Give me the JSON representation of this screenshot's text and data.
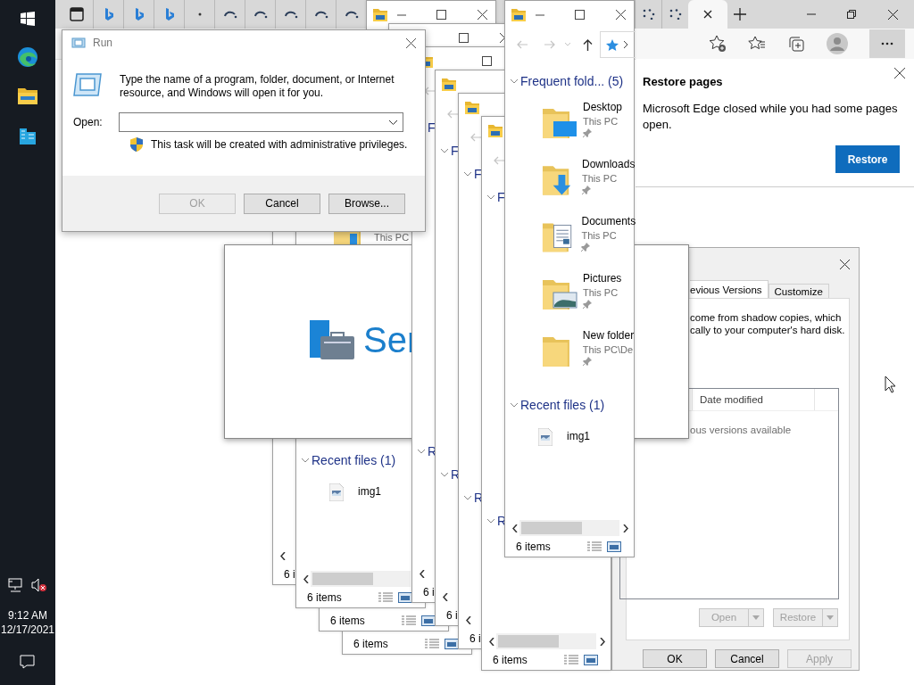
{
  "taskbar": {
    "apps": [
      {
        "kind": "start"
      },
      {
        "kind": "edge"
      },
      {
        "kind": "explorer"
      },
      {
        "kind": "server-manager"
      }
    ],
    "volume_muted": true,
    "time": "9:12 AM",
    "date": "12/17/2021"
  },
  "browser": {
    "tabs_left": [
      {
        "kind": "bing",
        "selected": false
      },
      {
        "kind": "bing",
        "selected": false
      },
      {
        "kind": "bing",
        "selected": false
      },
      {
        "kind": "dot",
        "selected": false
      },
      {
        "kind": "loading",
        "selected": false
      },
      {
        "kind": "loading",
        "selected": false
      },
      {
        "kind": "loading",
        "selected": false
      },
      {
        "kind": "loading",
        "selected": false
      },
      {
        "kind": "loading",
        "selected": false
      }
    ],
    "tabs_right": [
      {
        "kind": "dots",
        "selected": false
      },
      {
        "kind": "dots",
        "selected": false
      },
      {
        "kind": "blank",
        "selected": true
      }
    ],
    "restore_flyout": {
      "title": "Restore pages",
      "message": "Microsoft Edge closed while you had some pages open.",
      "button": "Restore"
    }
  },
  "properties_dialog": {
    "tabs": [
      {
        "label": "evious Versions",
        "selected": true
      },
      {
        "label": "Customize",
        "selected": false
      }
    ],
    "description": [
      "come from shadow copies, which",
      "cally to your computer's hard disk."
    ],
    "column": "Date modified",
    "empty_message": "ous versions available",
    "action_buttons": [
      {
        "label": "Open",
        "disabled": true
      },
      {
        "label": "Restore",
        "disabled": true
      }
    ],
    "buttons": [
      {
        "label": "OK",
        "disabled": false
      },
      {
        "label": "Cancel",
        "disabled": false
      },
      {
        "label": "Apply",
        "disabled": true
      }
    ]
  },
  "explorer_windows": [
    {
      "title_bar": {
        "icon": true,
        "minimize": true,
        "maximize": true,
        "close": true
      }
    },
    {
      "title_bar": {
        "maximize": true,
        "close": true
      }
    },
    {
      "status": "6 items",
      "view_buttons": true
    },
    {
      "status": "6 items",
      "view_buttons": true
    },
    {
      "scrollbar": {
        "left_arrow": true
      },
      "status": "6 i"
    },
    {
      "items": [
        {
          "kind": "downloads",
          "location": "This PC"
        }
      ],
      "recent_header": "Recent files (1)",
      "recent_items": [
        "img1"
      ],
      "scrollbar": {
        "left_arrow": true,
        "thumb": true
      },
      "status": "6 items",
      "view_buttons": true
    },
    {
      "title_bar": {
        "icon": true,
        "maximize": true
      },
      "nav": {
        "back": true
      },
      "frequent_header": "F",
      "recent_header": "R",
      "scrollbar": {
        "left_arrow": true
      },
      "status": "6 i"
    },
    {
      "title_bar": {
        "icon": true
      },
      "nav": {
        "back": true
      },
      "frequent_header": "F",
      "recent_header": "R",
      "scrollbar": {
        "left_arrow": true
      },
      "status": "6 i"
    },
    {
      "title_bar": {
        "icon": true
      },
      "nav": {
        "back": true
      },
      "frequent_header": "F",
      "recent_header": "R",
      "scrollbar": {
        "left_arrow": true
      },
      "status": "6 i"
    },
    {
      "title_bar": {
        "icon": true
      },
      "nav": {
        "back": true
      },
      "frequent_header": "F",
      "recent_header": "R",
      "scrollbar": {
        "left_arrow": true,
        "thumb": true,
        "right_arrow": true
      },
      "status": "6 items",
      "view_buttons": true
    },
    {
      "title_bar": {
        "icon": true,
        "minimize": true,
        "maximize": true,
        "close": true
      },
      "nav": {
        "back": true,
        "forward": true,
        "recent": true,
        "up": true,
        "address": true
      },
      "frequent_header": "Frequent fold... (5)",
      "items": [
        {
          "kind": "desktop",
          "name": "Desktop",
          "location": "This PC",
          "pinned": true
        },
        {
          "kind": "downloads",
          "name": "Downloads",
          "location": "This PC",
          "pinned": true
        },
        {
          "kind": "documents",
          "name": "Documents",
          "location": "This PC",
          "pinned": true
        },
        {
          "kind": "pictures",
          "name": "Pictures",
          "location": "This PC",
          "pinned": true
        },
        {
          "kind": "folder",
          "name": "New folder",
          "location": "This PC\\De",
          "pinned": true
        }
      ],
      "recent_header": "Recent files (1)",
      "recent_items": [
        "img1"
      ],
      "scrollbar": {
        "left_arrow": true,
        "thumb": true,
        "right_arrow": true
      },
      "status": "6 items",
      "view_buttons": true
    }
  ],
  "splash": {
    "title": "Ser"
  },
  "run_dialog": {
    "title": "Run",
    "prompt": "Type the name of a program, folder, document, or Internet resource, and Windows will open it for you.",
    "open_label": "Open:",
    "admin_note": "This task will be created with administrative privileges.",
    "buttons": [
      {
        "label": "OK",
        "disabled": true
      },
      {
        "label": "Cancel",
        "disabled": false
      },
      {
        "label": "Browse...",
        "disabled": false
      }
    ]
  }
}
